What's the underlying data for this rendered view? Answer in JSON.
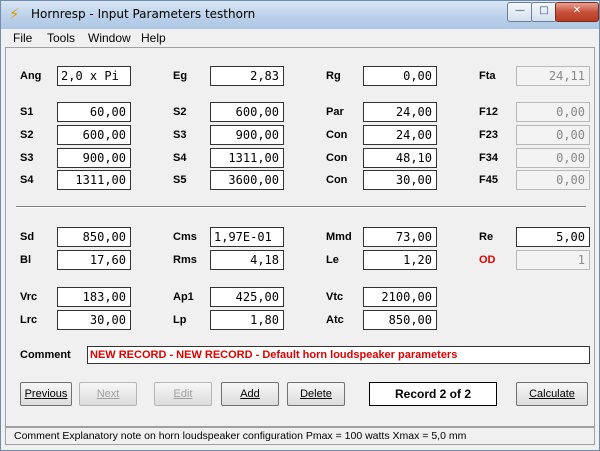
{
  "window": {
    "title": "Hornresp - Input Parameters   testhorn",
    "app_icon_glyph": "⚡",
    "minimize_glyph": "—",
    "maximize_glyph": "□",
    "close_glyph": "✕"
  },
  "menu": [
    "File",
    "Tools",
    "Window",
    "Help"
  ],
  "section1": {
    "col1": [
      {
        "label": "Ang",
        "value": "2,0 x Pi"
      },
      {
        "label": "S1",
        "value": "60,00"
      },
      {
        "label": "S2",
        "value": "600,00"
      },
      {
        "label": "S3",
        "value": "900,00"
      },
      {
        "label": "S4",
        "value": "1311,00"
      }
    ],
    "col2": [
      {
        "label": "Eg",
        "value": "2,83"
      },
      {
        "label": "S2",
        "value": "600,00"
      },
      {
        "label": "S3",
        "value": "900,00"
      },
      {
        "label": "S4",
        "value": "1311,00"
      },
      {
        "label": "S5",
        "value": "3600,00"
      }
    ],
    "col3": [
      {
        "label": "Rg",
        "value": "0,00"
      },
      {
        "label": "Par",
        "value": "24,00"
      },
      {
        "label": "Con",
        "value": "24,00"
      },
      {
        "label": "Con",
        "value": "48,10"
      },
      {
        "label": "Con",
        "value": "30,00"
      }
    ],
    "col4": [
      {
        "label": "Fta",
        "value": "24,11"
      },
      {
        "label": "F12",
        "value": "0,00"
      },
      {
        "label": "F23",
        "value": "0,00"
      },
      {
        "label": "F34",
        "value": "0,00"
      },
      {
        "label": "F45",
        "value": "0,00"
      }
    ]
  },
  "section2": {
    "col1": [
      {
        "label": "Sd",
        "value": "850,00"
      },
      {
        "label": "Bl",
        "value": "17,60"
      },
      {
        "label": "Vrc",
        "value": "183,00"
      },
      {
        "label": "Lrc",
        "value": "30,00"
      }
    ],
    "col2": [
      {
        "label": "Cms",
        "value": "1,97E-01"
      },
      {
        "label": "Rms",
        "value": "4,18"
      },
      {
        "label": "Ap1",
        "value": "425,00"
      },
      {
        "label": "Lp",
        "value": "1,80"
      }
    ],
    "col3": [
      {
        "label": "Mmd",
        "value": "73,00"
      },
      {
        "label": "Le",
        "value": "1,20"
      },
      {
        "label": "Vtc",
        "value": "2100,00"
      },
      {
        "label": "Atc",
        "value": "850,00"
      }
    ],
    "col4": [
      {
        "label": "Re",
        "value": "5,00"
      },
      {
        "label": "OD",
        "value": "1"
      }
    ]
  },
  "comment": {
    "label": "Comment",
    "value": "NEW RECORD - NEW RECORD - Default horn loudspeaker parameters"
  },
  "buttons": {
    "previous": "Previous",
    "next": "Next",
    "edit": "Edit",
    "add": "Add",
    "delete": "Delete",
    "record": "Record 2 of 2",
    "calculate": "Calculate"
  },
  "status": "Comment   Explanatory note on horn loudspeaker configuration   Pmax = 100 watts   Xmax = 5,0 mm",
  "colors": {
    "accent_red": "#e00000",
    "window_bg": "#f0f0f0"
  }
}
